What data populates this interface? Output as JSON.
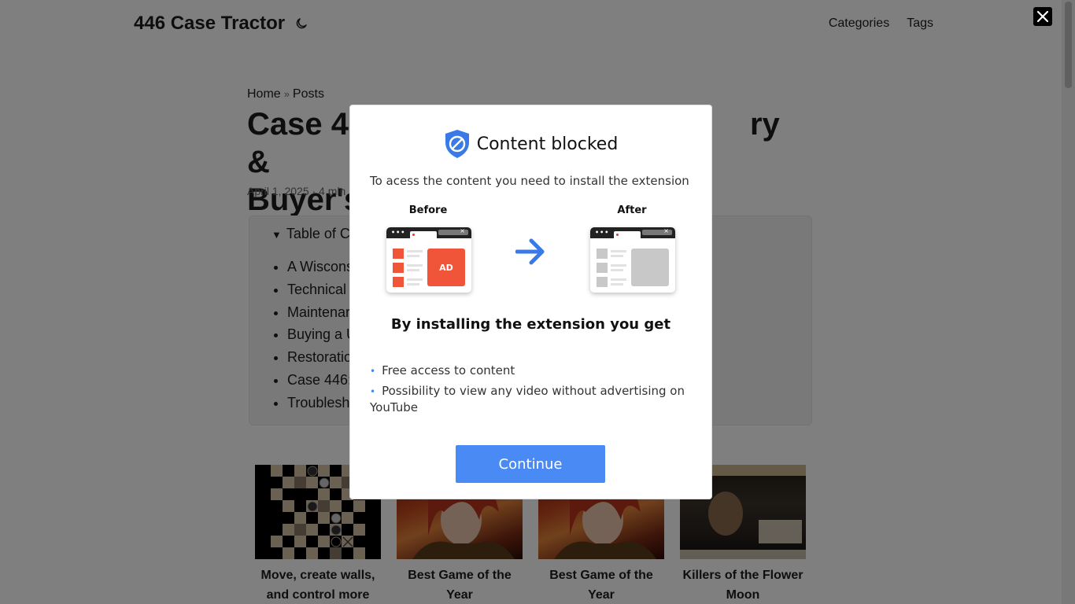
{
  "site": {
    "logo": "446 Case Tractor",
    "theme_toggle_icon": "moon-icon",
    "nav": [
      "Categories",
      "Tags"
    ]
  },
  "post": {
    "breadcrumb": [
      "Home",
      "Posts"
    ],
    "breadcrumb_sep": "»",
    "title_line1_left": "Case 4",
    "title_line1_right": "ry &",
    "title_line2": "Buyer's",
    "meta": "April 1, 2025 · 4 min"
  },
  "toc": {
    "summary": "Table of C",
    "items": [
      "A Wiscons",
      "Technical",
      "Maintenar",
      "Buying a U",
      "Restoratio",
      "Case 446:",
      "Troublesh"
    ]
  },
  "cards": [
    {
      "title": "Move, create walls, and control more",
      "image": "board-game-image"
    },
    {
      "title": "Best Game of the Year",
      "image": "fantasy-character-image"
    },
    {
      "title": "Best Game of the Year",
      "image": "fantasy-character-image"
    },
    {
      "title": "Killers of the Flower Moon",
      "image": "movie-poster-image"
    }
  ],
  "modal": {
    "title": "Content blocked",
    "subtitle": "To acess the content you need to install the extension",
    "before_label": "Before",
    "after_label": "After",
    "ad_label": "AD",
    "browser_dots": "•••",
    "browser_close": "×",
    "benefit_title": "By installing the extension you get",
    "benefits": [
      "Free access to content",
      "Possibility to view any video without advertising on YouTube"
    ],
    "bullet": "•",
    "continue_label": "Continue",
    "accent_color": "#4a8af4",
    "ad_color": "#f0553a"
  },
  "overlay_close_icon": "close-icon"
}
